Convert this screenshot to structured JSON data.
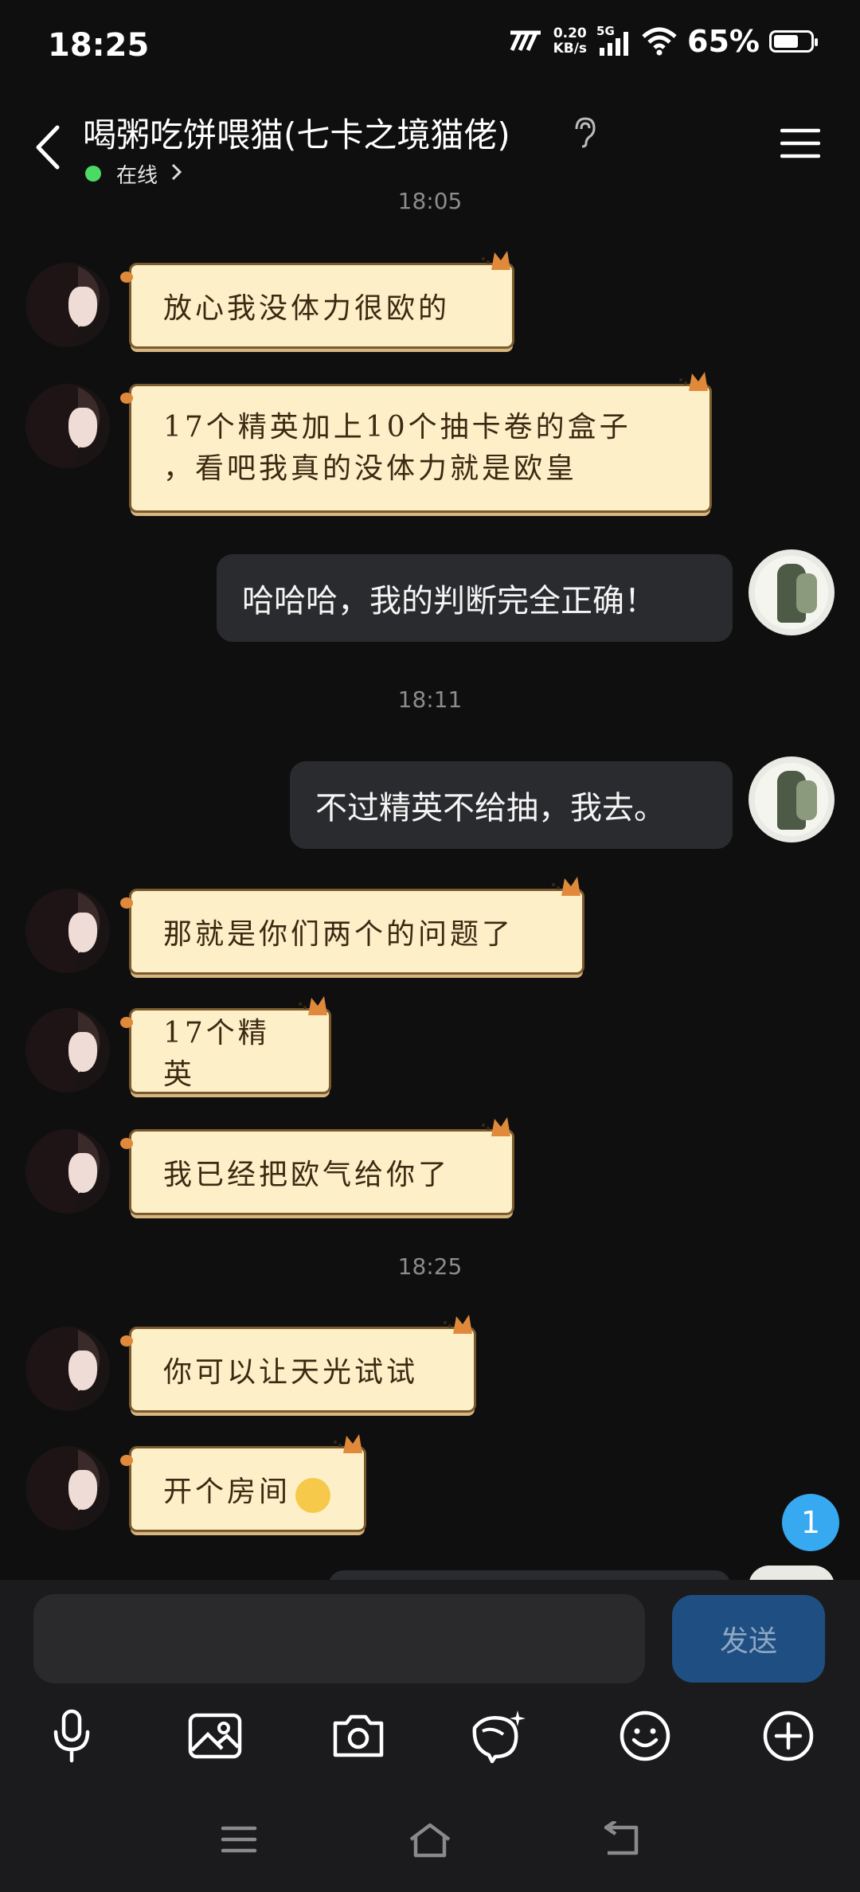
{
  "status_bar": {
    "time": "18:25",
    "net_speed_value": "0.20",
    "net_speed_unit": "KB/s",
    "network_type": "5G",
    "battery": "65%"
  },
  "header": {
    "title": "喝粥吃饼喂猫(七卡之境猫佬)",
    "presence": "在线"
  },
  "messages": {
    "t1": "18:05",
    "m1": "放心我没体力很欧的",
    "m2_line1": "17个精英加上10个抽卡卷的盒子",
    "m2_line2": "，看吧我真的没体力就是欧皇",
    "m3": "哈哈哈，我的判断完全正确！",
    "t2": "18:11",
    "m4": "不过精英不给抽，我去。",
    "m5": "那就是你们两个的问题了",
    "m6": "17个精英",
    "m7": "我已经把欧气给你了",
    "t3": "18:25",
    "m8": "你可以让天光试试",
    "m9": "开个房间"
  },
  "unread_badge": "1",
  "composer": {
    "send_label": "发送"
  },
  "colors": {
    "accent": "#37a9f0",
    "send_button": "#1f4f82",
    "scroll_bubble": "#fdf0c8",
    "my_bubble": "#2a2b2e"
  }
}
